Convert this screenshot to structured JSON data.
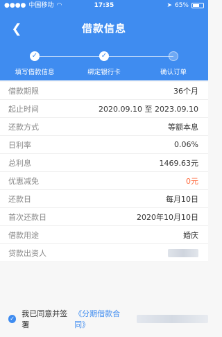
{
  "status_bar": {
    "carrier": "中国移动",
    "time": "17:35",
    "battery_percent": "65%",
    "battery_level": 0.65
  },
  "header": {
    "title": "借款信息"
  },
  "steps": [
    {
      "label": "填写借款信息",
      "done": true
    },
    {
      "label": "绑定银行卡",
      "done": true
    },
    {
      "label": "确认订单",
      "done": false
    }
  ],
  "info": [
    {
      "label": "借款期限",
      "value": "36个月"
    },
    {
      "label": "起止时间",
      "value": "2020.09.10 至 2023.09.10"
    },
    {
      "label": "还款方式",
      "value": "等额本息"
    },
    {
      "label": "日利率",
      "value": "0.06%"
    },
    {
      "label": "总利息",
      "value": "1469.63元"
    },
    {
      "label": "优惠减免",
      "value": "0元",
      "highlight": true
    },
    {
      "label": "还款日",
      "value": "每月10日"
    },
    {
      "label": "首次还款日",
      "value": "2020年10月10日"
    },
    {
      "label": "借款用途",
      "value": "婚庆"
    },
    {
      "label": "贷款出资人",
      "value": ""
    }
  ],
  "agreement": {
    "text": "我已同意并签署",
    "contract": "《分期借款合同》"
  },
  "colors": {
    "primary": "#3f8cf0",
    "highlight": "#ff6a3c"
  },
  "icons": {
    "back": "chevron-left-icon",
    "check": "check-icon",
    "wifi": "wifi-icon",
    "battery": "battery-icon"
  }
}
